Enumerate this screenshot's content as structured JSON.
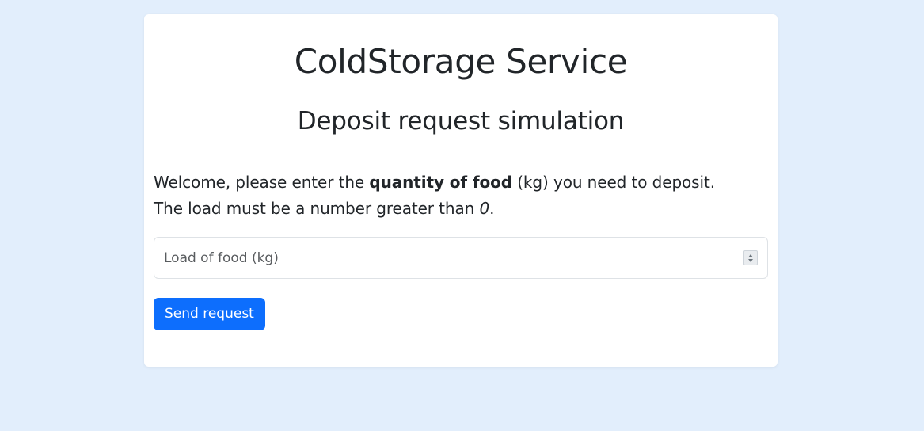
{
  "page": {
    "title": "ColdStorage Service",
    "subtitle": "Deposit request simulation"
  },
  "intro": {
    "line1_before": "Welcome, please enter the ",
    "line1_bold": "quantity of food",
    "line1_after": " (kg) you need to deposit.",
    "line2_before": "The load must be a number greater than ",
    "line2_italic": "0",
    "line2_after": "."
  },
  "form": {
    "load_placeholder": "Load of food (kg)",
    "load_value": "",
    "submit_label": "Send request"
  },
  "colors": {
    "background": "#e2eefc",
    "card": "#ffffff",
    "primary": "#0d6efd",
    "text": "#212529"
  }
}
